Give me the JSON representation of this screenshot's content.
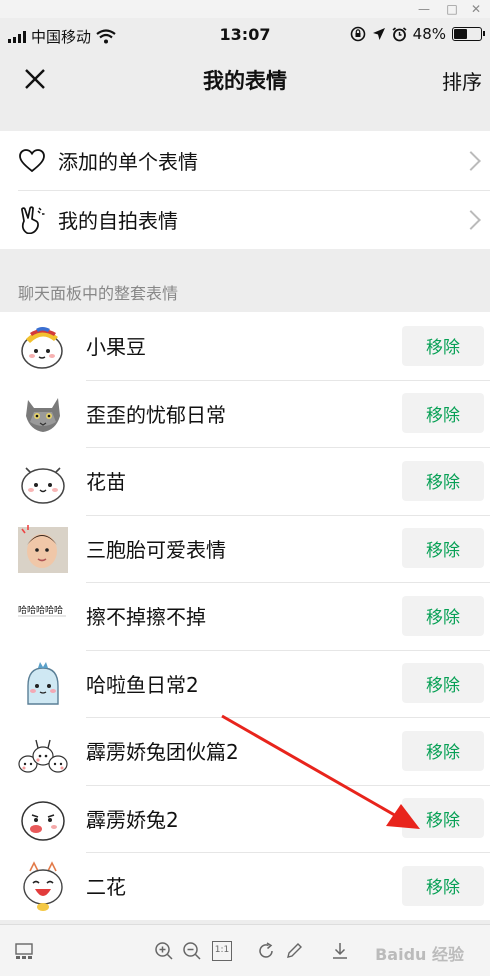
{
  "statusbar": {
    "carrier": "中国移动",
    "time": "13:07",
    "battery": "48%",
    "battery_level": 0.48
  },
  "navbar": {
    "title": "我的表情",
    "sort_label": "排序"
  },
  "top_items": [
    {
      "label": "添加的单个表情",
      "icon": "heart-icon"
    },
    {
      "label": "我的自拍表情",
      "icon": "selfie-hand-icon"
    }
  ],
  "section_header": "聊天面板中的整套表情",
  "stickers": [
    {
      "name": "小果豆",
      "remove_label": "移除"
    },
    {
      "name": "歪歪的忧郁日常",
      "remove_label": "移除"
    },
    {
      "name": "花苗",
      "remove_label": "移除"
    },
    {
      "name": "三胞胎可爱表情",
      "remove_label": "移除"
    },
    {
      "name": "擦不掉擦不掉",
      "remove_label": "移除",
      "thumb_text": "哈哈哈哈哈"
    },
    {
      "name": "哈啦鱼日常2",
      "remove_label": "移除"
    },
    {
      "name": "霹雳娇兔团伙篇2",
      "remove_label": "移除"
    },
    {
      "name": "霹雳娇兔2",
      "remove_label": "移除"
    },
    {
      "name": "二花",
      "remove_label": "移除"
    }
  ],
  "toolbar": {
    "zoom_reset_label": "1:1"
  },
  "watermark": "Baidu 经验",
  "colors": {
    "accent_green": "#07a055",
    "annotation_red": "#e8241c"
  }
}
